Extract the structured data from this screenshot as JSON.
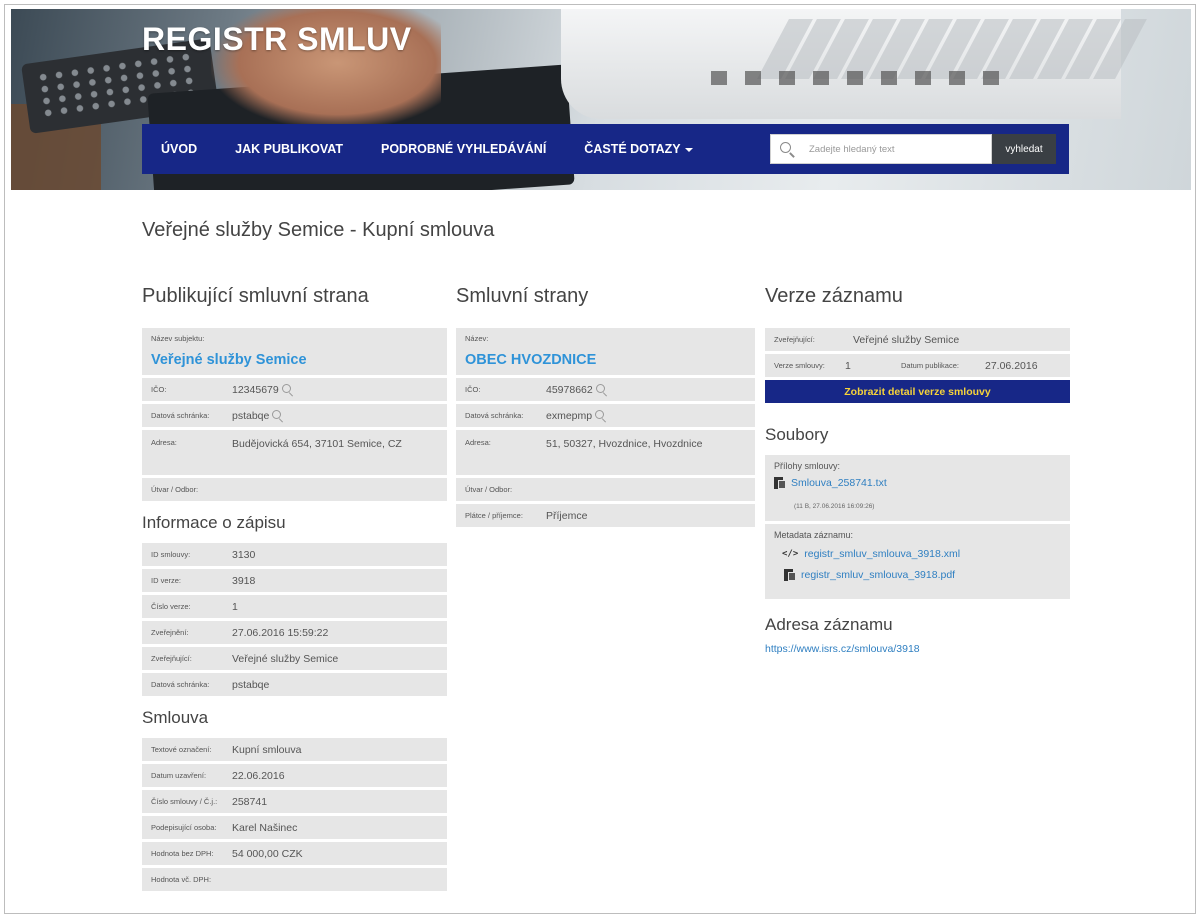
{
  "header": {
    "site_title": "REGISTR SMLUV",
    "nav": [
      {
        "label": "ÚVOD"
      },
      {
        "label": "JAK PUBLIKOVAT"
      },
      {
        "label": "PODROBNÉ VYHLEDÁVÁNÍ"
      },
      {
        "label": "ČASTÉ DOTAZY"
      }
    ],
    "search": {
      "placeholder": "Zadejte hledaný text",
      "button": "vyhledat"
    }
  },
  "page_title": "Veřejné služby Semice - Kupní smlouva",
  "publisher": {
    "heading": "Publikující smluvní strana",
    "name_label": "Název subjektu:",
    "name": "Veřejné služby Semice",
    "ico_label": "IČO:",
    "ico": "12345679",
    "box_label": "Datová schránka:",
    "box": "pstabqe",
    "address_label": "Adresa:",
    "address": "Budějovická 654, 37101 Semice, CZ",
    "dept_label": "Útvar / Odbor:",
    "dept": ""
  },
  "record_info": {
    "heading": "Informace o zápisu",
    "rows": [
      {
        "label": "ID smlouvy:",
        "value": "3130"
      },
      {
        "label": "ID verze:",
        "value": "3918"
      },
      {
        "label": "Číslo verze:",
        "value": "1"
      },
      {
        "label": "Zveřejnění:",
        "value": "27.06.2016 15:59:22"
      },
      {
        "label": "Zveřejňující:",
        "value": "Veřejné služby Semice"
      },
      {
        "label": "Datová schránka:",
        "value": "pstabqe"
      }
    ]
  },
  "contract": {
    "heading": "Smlouva",
    "rows": [
      {
        "label": "Textové označení:",
        "value": "Kupní smlouva"
      },
      {
        "label": "Datum uzavření:",
        "value": "22.06.2016"
      },
      {
        "label": "Číslo smlouvy / Č.j.:",
        "value": "258741"
      },
      {
        "label": "Podepisující osoba:",
        "value": "Karel Našinec"
      },
      {
        "label": "Hodnota bez DPH:",
        "value": "54 000,00 CZK"
      },
      {
        "label": "Hodnota vč. DPH:",
        "value": ""
      }
    ]
  },
  "parties": {
    "heading": "Smluvní strany",
    "name_label": "Název:",
    "name": "OBEC HVOZDNICE",
    "ico_label": "IČO:",
    "ico": "45978662",
    "box_label": "Datová schránka:",
    "box": "exmepmp",
    "address_label": "Adresa:",
    "address": "51, 50327, Hvozdnice, Hvozdnice",
    "dept_label": "Útvar / Odbor:",
    "dept": "",
    "role_label": "Plátce / příjemce:",
    "role": "Příjemce"
  },
  "version": {
    "heading": "Verze záznamu",
    "publisher_label": "Zveřejňující:",
    "publisher": "Veřejné služby Semice",
    "version_label": "Verze smlouvy:",
    "version": "1",
    "date_label": "Datum publikace:",
    "date": "27.06.2016",
    "detail_button": "Zobrazit detail verze smlouvy"
  },
  "files": {
    "heading": "Soubory",
    "attachments_label": "Přílohy smlouvy:",
    "attachment_name": "Smlouva_258741.txt",
    "attachment_meta": "(11 B, 27.06.2016 16:09:26)",
    "metadata_label": "Metadata záznamu:",
    "metadata_xml": "registr_smluv_smlouva_3918.xml",
    "metadata_pdf": "registr_smluv_smlouva_3918.pdf"
  },
  "record_address": {
    "heading": "Adresa záznamu",
    "url": "https://www.isrs.cz/smlouva/3918"
  }
}
